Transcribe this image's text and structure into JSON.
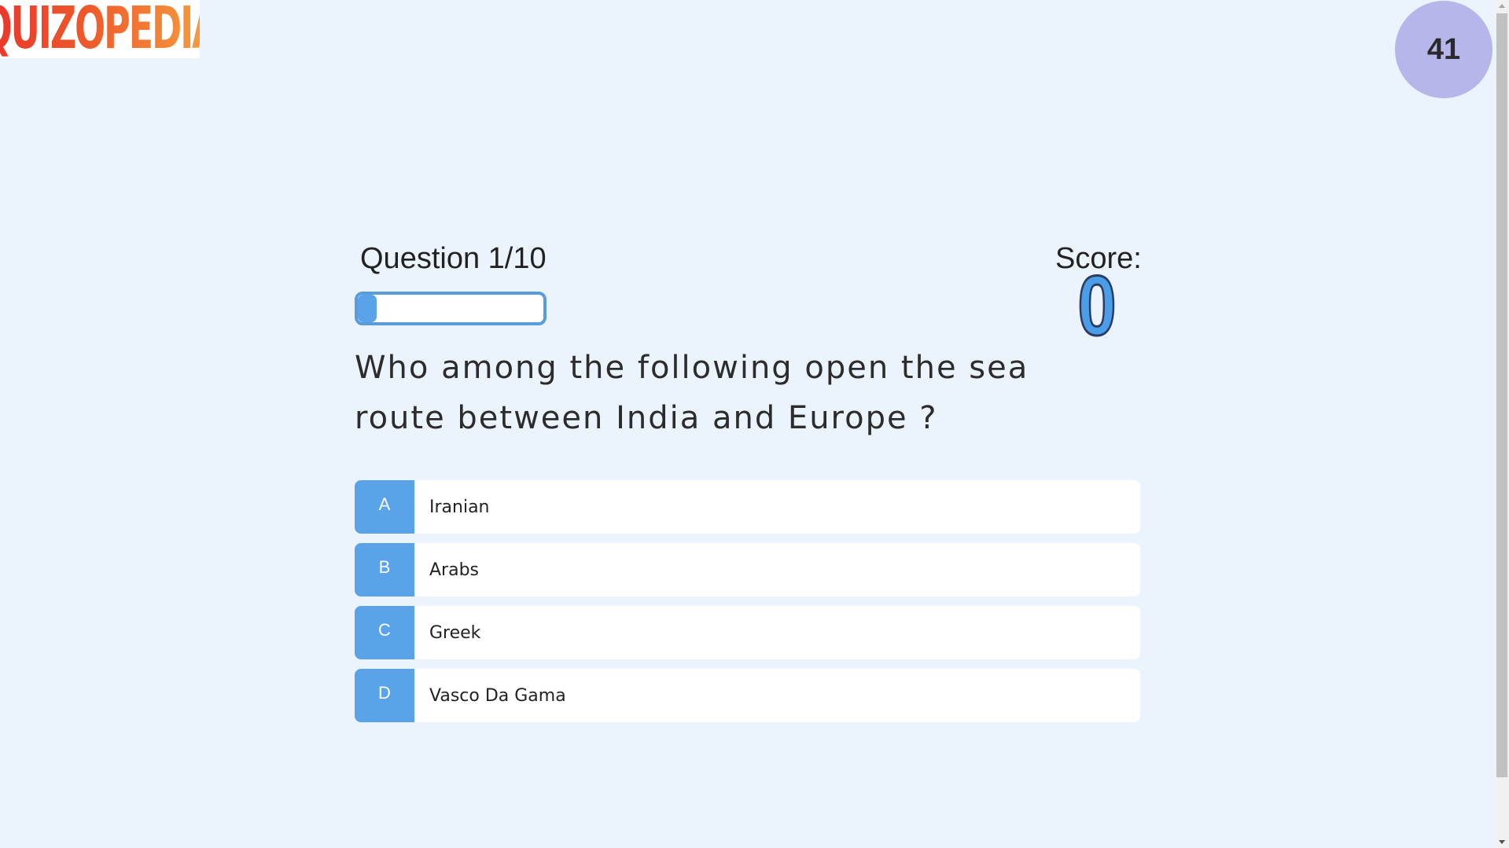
{
  "brand": {
    "logo_text": "QUIZOPEDIA"
  },
  "timer": {
    "value": "41"
  },
  "quiz": {
    "question_counter": "Question 1/10",
    "progress_fraction": 0.1,
    "score_label": "Score:",
    "score_value": "0",
    "question": "Who among the following open the sea route between India and Europe ?",
    "options": [
      {
        "letter": "A",
        "text": "Iranian"
      },
      {
        "letter": "B",
        "text": "Arabs"
      },
      {
        "letter": "C",
        "text": "Greek"
      },
      {
        "letter": "D",
        "text": "Vasco Da Gama"
      }
    ]
  },
  "colors": {
    "background": "#ebf3fd",
    "accent": "#5aa3e8",
    "timer_circle": "#b7b6ea"
  }
}
